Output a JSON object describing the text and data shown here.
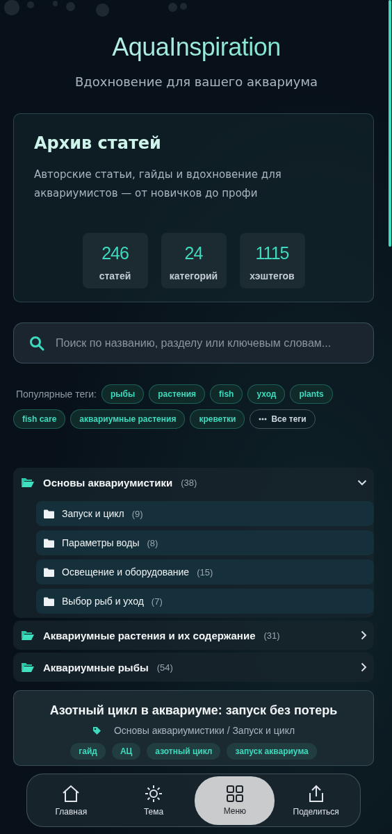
{
  "header": {
    "logo": "AquaInspiration",
    "tagline": "Вдохновение для вашего аквариума"
  },
  "archive": {
    "title": "Архив статей",
    "description": "Авторские статьи, гайды и вдохновение для аквариумистов — от новичков до профи",
    "stats": [
      {
        "value": "246",
        "label": "статей"
      },
      {
        "value": "24",
        "label": "категорий"
      },
      {
        "value": "1115",
        "label": "хэштегов"
      }
    ]
  },
  "search": {
    "placeholder": "Поиск по названию, разделу или ключевым словам..."
  },
  "popular_tags": {
    "label": "Популярные теги:",
    "tags": [
      "рыбы",
      "растения",
      "fish",
      "уход",
      "plants",
      "fish care",
      "аквариумные растения",
      "креветки"
    ],
    "all_tags_button": "Все теги"
  },
  "categories": [
    {
      "name": "Основы аквариумистики",
      "count": "(38)",
      "expanded": true,
      "children": [
        {
          "name": "Запуск и цикл",
          "count": "(9)"
        },
        {
          "name": "Параметры воды",
          "count": "(8)"
        },
        {
          "name": "Освещение и оборудование",
          "count": "(15)"
        },
        {
          "name": "Выбор рыб и уход",
          "count": "(7)"
        }
      ]
    },
    {
      "name": "Аквариумные растения и их содержание",
      "count": "(31)",
      "expanded": false
    },
    {
      "name": "Аквариумные рыбы",
      "count": "(54)",
      "expanded": false
    }
  ],
  "article": {
    "title": "Азотный цикл в аквариуме: запуск без потерь",
    "breadcrumb": "Основы аквариумистики / Запуск и цикл",
    "tags": [
      "гайд",
      "АЦ",
      "азотный цикл",
      "запуск аквариума"
    ]
  },
  "bottom_nav": [
    {
      "kind": "home",
      "label": "Главная",
      "selected": false
    },
    {
      "kind": "theme",
      "label": "Тема",
      "selected": false
    },
    {
      "kind": "menu",
      "label": "Меню",
      "selected": true
    },
    {
      "kind": "share",
      "label": "Поделиться",
      "selected": false
    }
  ]
}
